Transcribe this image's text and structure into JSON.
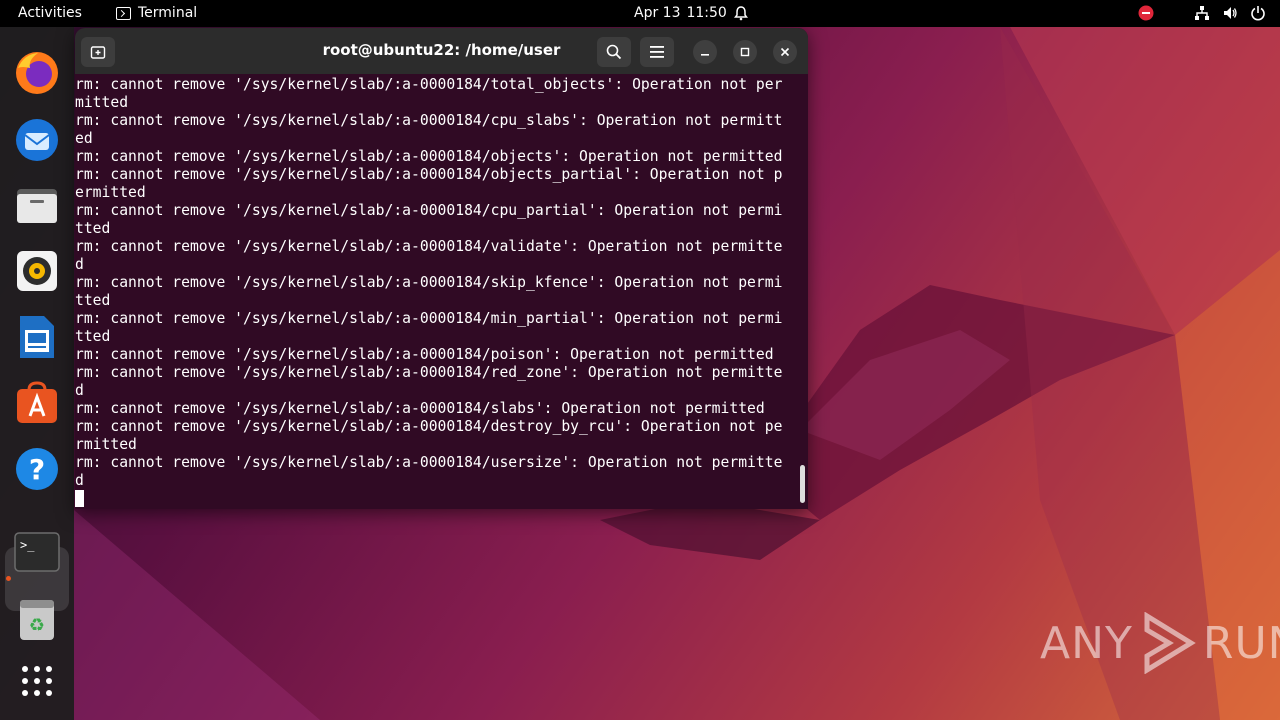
{
  "topbar": {
    "activities": "Activities",
    "app_name": "Terminal",
    "date": "Apr 13",
    "time": "11:50"
  },
  "window": {
    "title": "root@ubuntu22: /home/user"
  },
  "terminal_lines": [
    "rm: cannot remove '/sys/kernel/slab/:a-0000184/total_objects': Operation not per",
    "mitted",
    "rm: cannot remove '/sys/kernel/slab/:a-0000184/cpu_slabs': Operation not permitt",
    "ed",
    "rm: cannot remove '/sys/kernel/slab/:a-0000184/objects': Operation not permitted",
    "rm: cannot remove '/sys/kernel/slab/:a-0000184/objects_partial': Operation not p",
    "ermitted",
    "rm: cannot remove '/sys/kernel/slab/:a-0000184/cpu_partial': Operation not permi",
    "tted",
    "rm: cannot remove '/sys/kernel/slab/:a-0000184/validate': Operation not permitte",
    "d",
    "rm: cannot remove '/sys/kernel/slab/:a-0000184/skip_kfence': Operation not permi",
    "tted",
    "rm: cannot remove '/sys/kernel/slab/:a-0000184/min_partial': Operation not permi",
    "tted",
    "rm: cannot remove '/sys/kernel/slab/:a-0000184/poison': Operation not permitted",
    "rm: cannot remove '/sys/kernel/slab/:a-0000184/red_zone': Operation not permitte",
    "d",
    "rm: cannot remove '/sys/kernel/slab/:a-0000184/slabs': Operation not permitted",
    "rm: cannot remove '/sys/kernel/slab/:a-0000184/destroy_by_rcu': Operation not pe",
    "rmitted",
    "rm: cannot remove '/sys/kernel/slab/:a-0000184/usersize': Operation not permitte",
    "d"
  ],
  "dock": {
    "items": [
      "firefox-icon",
      "thunderbird-icon",
      "files-icon",
      "rhythmbox-icon",
      "libreoffice-writer-icon",
      "app-center-icon",
      "help-icon",
      "terminal-icon",
      "trash-icon",
      "show-apps-icon"
    ]
  },
  "watermark": {
    "left": "ANY",
    "right": "RUN"
  },
  "colors": {
    "terminal_bg": "#300a24",
    "accent": "#e95420"
  }
}
